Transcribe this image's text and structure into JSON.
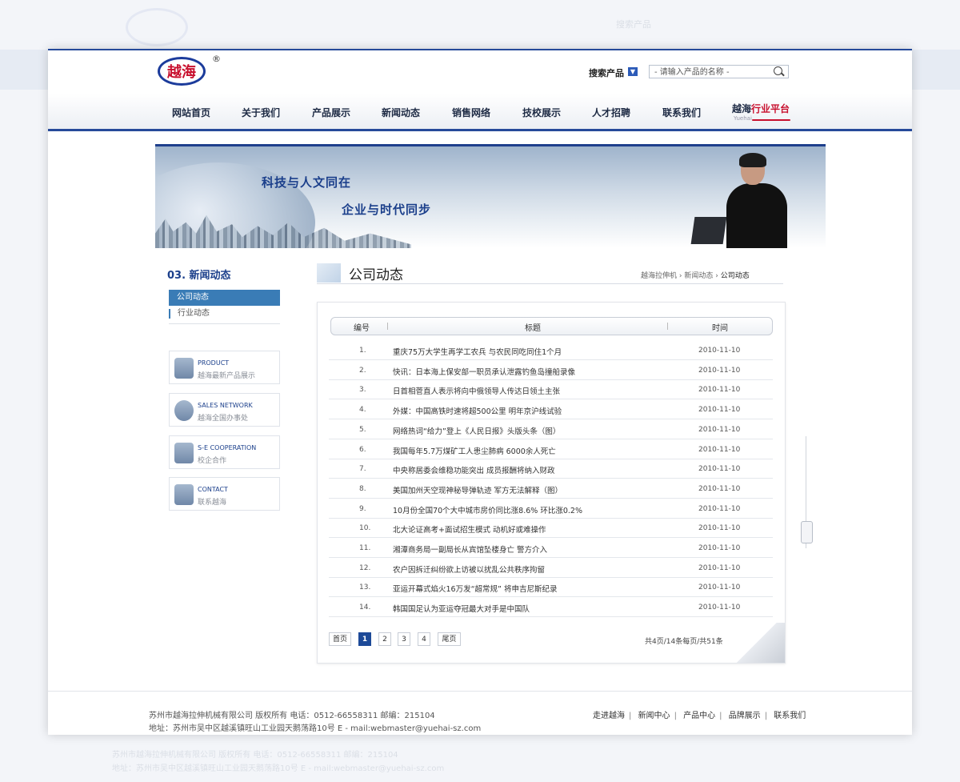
{
  "brand": {
    "logo_text": "越海",
    "registered": "®"
  },
  "search": {
    "label": "搜索产品",
    "placeholder": "- 请输入产品的名称 -"
  },
  "nav": {
    "items": [
      "网站首页",
      "关于我们",
      "产品展示",
      "新闻动态",
      "销售网络",
      "技校展示",
      "人才招聘",
      "联系我们"
    ],
    "platform": {
      "part1": "越海",
      "part2": "行业平台",
      "sub": "Yuehai"
    }
  },
  "banner": {
    "slogan1": "科技与人文同在",
    "slogan2": "企业与时代同步"
  },
  "sidebar": {
    "title": "03. 新闻动态",
    "menu": [
      {
        "label": "公司动态",
        "active": true
      },
      {
        "label": "行业动态",
        "active": false
      }
    ],
    "boxes": [
      {
        "en": "PRODUCT",
        "cn": "越海最新产品展示",
        "icon": "product-icon"
      },
      {
        "en": "SALES NETWORK",
        "cn": "越海全国办事处",
        "icon": "globe-icon"
      },
      {
        "en": "S-E COOPERATION",
        "cn": "校企合作",
        "icon": "buildings-icon"
      },
      {
        "en": "CONTACT",
        "cn": "联系越海",
        "icon": "phone-icon"
      }
    ]
  },
  "content": {
    "heading": "公司动态",
    "breadcrumb": [
      "越海拉伸机",
      "新闻动态",
      "公司动态"
    ],
    "table": {
      "headers": [
        "编号",
        "标题",
        "时间"
      ],
      "rows": [
        {
          "num": "1.",
          "title": "重庆75万大学生再学工农兵 与农民同吃同住1个月",
          "date": "2010-11-10"
        },
        {
          "num": "2.",
          "title": "快讯：日本海上保安部一职员承认泄露钓鱼岛撞船录像",
          "date": "2010-11-10"
        },
        {
          "num": "3.",
          "title": "日首相菅直人表示将向中俄领导人传达日领土主张",
          "date": "2010-11-10"
        },
        {
          "num": "4.",
          "title": "外媒：中国高铁时速将超500公里 明年京沪线试验",
          "date": "2010-11-10"
        },
        {
          "num": "5.",
          "title": "网络热词“给力”登上《人民日报》头版头条（图）",
          "date": "2010-11-10"
        },
        {
          "num": "6.",
          "title": "我国每年5.7万煤矿工人患尘肺病 6000余人死亡",
          "date": "2010-11-10"
        },
        {
          "num": "7.",
          "title": "中央称居委会维稳功能突出 成员报酬将纳入财政",
          "date": "2010-11-10"
        },
        {
          "num": "8.",
          "title": "美国加州天空现神秘导弹轨迹 军方无法解释（图）",
          "date": "2010-11-10"
        },
        {
          "num": "9.",
          "title": "10月份全国70个大中城市房价同比涨8.6% 环比涨0.2%",
          "date": "2010-11-10"
        },
        {
          "num": "10.",
          "title": "北大论证高考+面试招生模式 动机好或难操作",
          "date": "2010-11-10"
        },
        {
          "num": "11.",
          "title": "湘潭商务局一副局长从宾馆坠楼身亡 警方介入",
          "date": "2010-11-10"
        },
        {
          "num": "12.",
          "title": "农户因拆迁纠纷欲上访被以扰乱公共秩序拘留",
          "date": "2010-11-10"
        },
        {
          "num": "13.",
          "title": "亚运开幕式焰火16万发“超常规” 将申吉尼斯纪录",
          "date": "2010-11-10"
        },
        {
          "num": "14.",
          "title": "韩国国足认为亚运夺冠最大对手是中国队",
          "date": "2010-11-10"
        }
      ]
    },
    "pager": {
      "first": "首页",
      "pages": [
        "1",
        "2",
        "3",
        "4"
      ],
      "last": "尾页",
      "current": "1",
      "info": "共4页/14条每页/共51条"
    }
  },
  "footer": {
    "line1": "苏州市越海拉伸机械有限公司 版权所有  电话：0512-66558311  邮编：215104",
    "line2": "地址：苏州市吴中区越溪镇旺山工业园天鹅荡路10号  E - mail:webmaster@yuehai-sz.com",
    "links": [
      "走进越海",
      "新闻中心",
      "产品中心",
      "品牌展示",
      "联系我们"
    ]
  }
}
